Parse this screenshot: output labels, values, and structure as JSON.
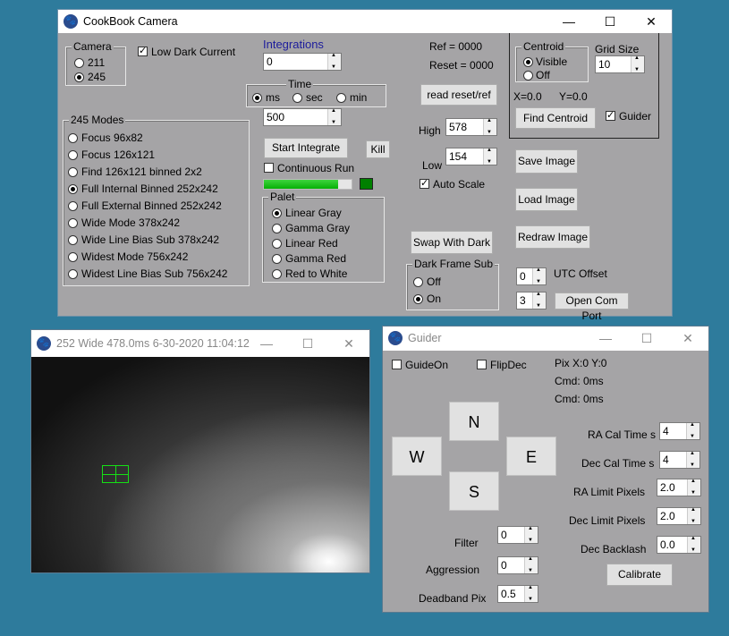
{
  "main_window": {
    "title": "CookBook Camera",
    "camera": {
      "legend": "Camera",
      "options": [
        "211",
        "245"
      ],
      "selected": "245"
    },
    "low_dark_current": {
      "label": "Low Dark Current",
      "checked": true
    },
    "integrations": {
      "label": "Integrations",
      "value": "0"
    },
    "time": {
      "legend": "Time",
      "options": [
        "ms",
        "sec",
        "min"
      ],
      "selected": "ms",
      "value": "500"
    },
    "ref_text": "Ref = 0000",
    "reset_text": "Reset = 0000",
    "read_reset_button": "read reset/ref",
    "centroid": {
      "legend": "Centroid",
      "options": [
        "Visible",
        "Off"
      ],
      "selected": "Visible"
    },
    "grid_size": {
      "label": "Grid Size",
      "value": "10"
    },
    "x_readout": "X=0.0",
    "y_readout": "Y=0.0",
    "find_centroid_button": "Find Centroid",
    "guider_check": {
      "label": "Guider",
      "checked": true
    },
    "modes": {
      "legend": "245 Modes",
      "selected": "Full Internal Binned 252x242",
      "items": [
        "Focus 96x82",
        "Focus 126x121",
        "Find 126x121 binned 2x2",
        "Full Internal Binned 252x242",
        "Full External Binned 252x242",
        "Wide Mode 378x242",
        "Wide Line Bias Sub 378x242",
        "Widest Mode 756x242",
        "Widest Line Bias Sub 756x242"
      ]
    },
    "start_integrate_button": "Start Integrate",
    "kill_button": "Kill",
    "continuous_run": {
      "label": "Continuous Run",
      "checked": false
    },
    "progress": 0.85,
    "status_color": "#008000",
    "high": {
      "label": "High",
      "value": "578"
    },
    "low": {
      "label": "Low",
      "value": "154"
    },
    "auto_scale": {
      "label": "Auto Scale",
      "checked": true
    },
    "save_image_button": "Save Image",
    "load_image_button": "Load Image",
    "redraw_image_button": "Redraw Image",
    "palet": {
      "legend": "Palet",
      "options": [
        "Linear Gray",
        "Gamma Gray",
        "Linear Red",
        "Gamma Red",
        "Red to White"
      ],
      "selected": "Linear Gray"
    },
    "swap_with_dark_button": "Swap With Dark",
    "dark_frame_sub": {
      "legend": "Dark Frame Sub",
      "options": [
        "Off",
        "On"
      ],
      "selected": "On"
    },
    "utc_offset": {
      "label": "UTC Offset",
      "value": "0"
    },
    "com_port": {
      "value": "3",
      "button": "Open Com Port"
    }
  },
  "image_window": {
    "title": "252 Wide 478.0ms 6-30-2020 11:04:12"
  },
  "guider_window": {
    "title": "Guider",
    "guide_on": {
      "label": "GuideOn",
      "checked": false
    },
    "flip_dec": {
      "label": "FlipDec",
      "checked": false
    },
    "pix": "Pix X:0 Y:0",
    "cmd1": "Cmd: 0ms",
    "cmd2": "Cmd: 0ms",
    "dirs": {
      "n": "N",
      "w": "W",
      "e": "E",
      "s": "S"
    },
    "ra_cal_time": {
      "label": "RA Cal Time s",
      "value": "4"
    },
    "dec_cal_time": {
      "label": "Dec Cal Time s",
      "value": "4"
    },
    "ra_limit": {
      "label": "RA Limit Pixels",
      "value": "2.0"
    },
    "dec_limit": {
      "label": "Dec Limit Pixels",
      "value": "2.0"
    },
    "dec_backlash": {
      "label": "Dec Backlash",
      "value": "0.0"
    },
    "calibrate_button": "Calibrate",
    "filter": {
      "label": "Filter",
      "value": "0"
    },
    "aggression": {
      "label": "Aggression",
      "value": "0"
    },
    "deadband": {
      "label": "Deadband Pix",
      "value": "0.5"
    }
  },
  "titlebar_controls": {
    "minimize": "—",
    "maximize": "☐",
    "close": "✕"
  }
}
